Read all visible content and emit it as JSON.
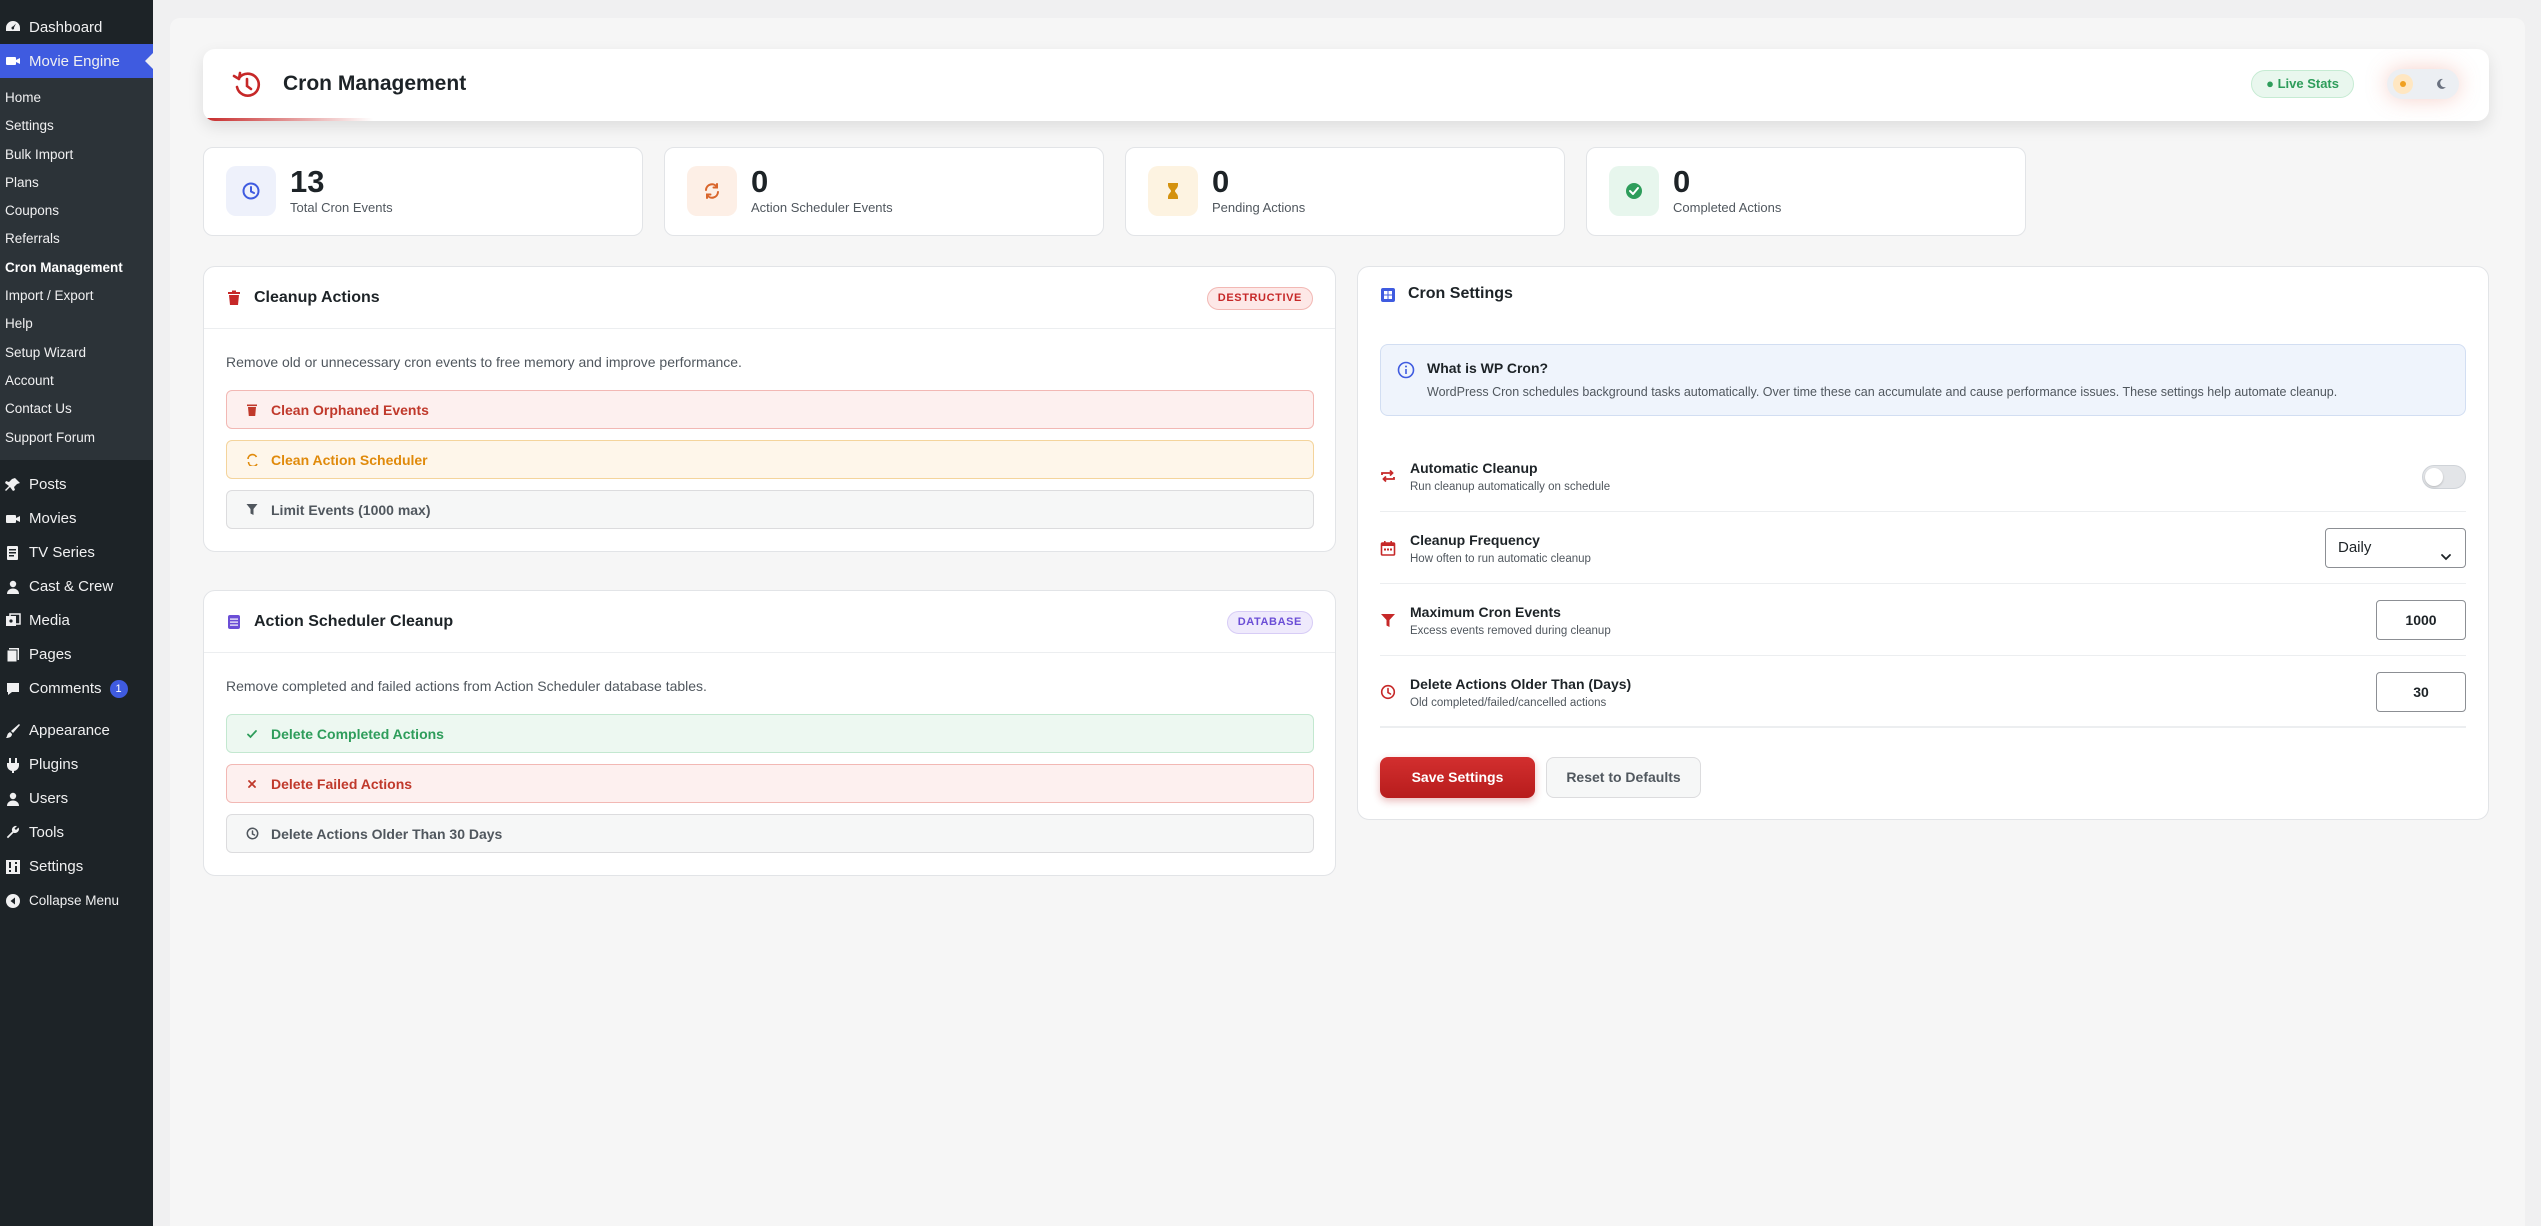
{
  "sidebar": {
    "top_items": [
      {
        "label": "Dashboard",
        "icon": "dashboard-icon"
      },
      {
        "label": "Movie Engine",
        "icon": "video-icon"
      }
    ],
    "submenu": [
      "Home",
      "Settings",
      "Bulk Import",
      "Plans",
      "Coupons",
      "Referrals",
      "Cron Management",
      "Import / Export",
      "Help",
      "Setup Wizard",
      "Account",
      "Contact Us",
      "Support Forum"
    ],
    "current_submenu": "Cron Management",
    "items": [
      {
        "label": "Posts",
        "icon": "pin-icon"
      },
      {
        "label": "Movies",
        "icon": "video-icon"
      },
      {
        "label": "TV Series",
        "icon": "document-icon"
      },
      {
        "label": "Cast & Crew",
        "icon": "user-icon"
      },
      {
        "label": "Media",
        "icon": "media-icon"
      },
      {
        "label": "Pages",
        "icon": "pages-icon"
      },
      {
        "label": "Comments",
        "icon": "comment-icon",
        "badge": "1"
      },
      {
        "label": "Appearance",
        "icon": "brush-icon"
      },
      {
        "label": "Plugins",
        "icon": "plugin-icon"
      },
      {
        "label": "Users",
        "icon": "user-icon"
      },
      {
        "label": "Tools",
        "icon": "wrench-icon"
      },
      {
        "label": "Settings",
        "icon": "settings-icon"
      },
      {
        "label": "Collapse Menu",
        "icon": "collapse-icon"
      }
    ]
  },
  "header": {
    "title": "Cron Management",
    "live_stats": "Live Stats"
  },
  "stats": [
    {
      "value": "13",
      "label": "Total Cron Events",
      "icon": "clock-icon",
      "color": "#3f5be0",
      "bg": "#eef1fb"
    },
    {
      "value": "0",
      "label": "Action Scheduler Events",
      "icon": "sync-icon",
      "color": "#d9652b",
      "bg": "#fdefe6"
    },
    {
      "value": "0",
      "label": "Pending Actions",
      "icon": "hourglass-icon",
      "color": "#d4920f",
      "bg": "#fdf3e1"
    },
    {
      "value": "0",
      "label": "Completed Actions",
      "icon": "check-circle-icon",
      "color": "#2e9d5b",
      "bg": "#e7f6ed"
    }
  ],
  "cleanup": {
    "title": "Cleanup Actions",
    "tag": "DESTRUCTIVE",
    "desc": "Remove old or unnecessary cron events to free memory and improve performance.",
    "buttons": [
      "Clean Orphaned Events",
      "Clean Action Scheduler",
      "Limit Events (1000 max)"
    ]
  },
  "scheduler": {
    "title": "Action Scheduler Cleanup",
    "tag": "DATABASE",
    "desc": "Remove completed and failed actions from Action Scheduler database tables.",
    "buttons": [
      "Delete Completed Actions",
      "Delete Failed Actions",
      "Delete Actions Older Than 30 Days"
    ]
  },
  "settings": {
    "title": "Cron Settings",
    "info_title": "What is WP Cron?",
    "info_text": "WordPress Cron schedules background tasks automatically. Over time these can accumulate and cause performance issues. These settings help automate cleanup.",
    "rows": [
      {
        "title": "Automatic Cleanup",
        "desc": "Run cleanup automatically on schedule",
        "enabled": false
      },
      {
        "title": "Cleanup Frequency",
        "desc": "How often to run automatic cleanup",
        "value": "Daily"
      },
      {
        "title": "Maximum Cron Events",
        "desc": "Excess events removed during cleanup",
        "value": "1000"
      },
      {
        "title": "Delete Actions Older Than (Days)",
        "desc": "Old completed/failed/cancelled actions",
        "value": "30"
      }
    ],
    "save_label": "Save Settings",
    "reset_label": "Reset to Defaults"
  },
  "colors": {
    "accent": "#3f5be0",
    "danger": "#c62828",
    "sidebar_bg": "#1d2327"
  }
}
